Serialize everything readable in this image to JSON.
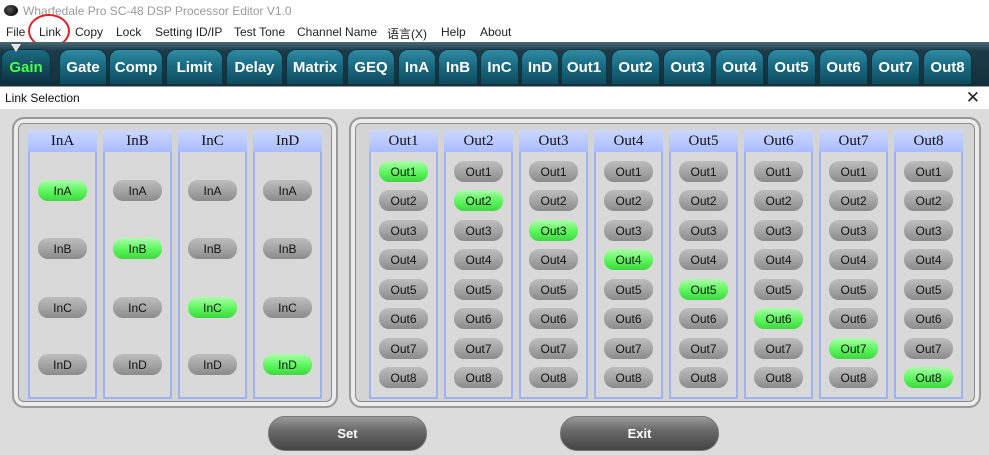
{
  "window": {
    "title": "Wharfedale Pro SC-48 DSP Processor Editor V1.0",
    "icon": "speaker-logo-icon"
  },
  "menu": [
    "File",
    "Link",
    "Copy",
    "Lock",
    "Setting ID/IP",
    "Test Tone",
    "Channel Name",
    "语言(X)",
    "Help",
    "About"
  ],
  "tabs": [
    "Gain",
    "Gate",
    "Comp",
    "Limit",
    "Delay",
    "Matrix",
    "GEQ",
    "InA",
    "InB",
    "InC",
    "InD",
    "Out1",
    "Out2",
    "Out3",
    "Out4",
    "Out5",
    "Out6",
    "Out7",
    "Out8"
  ],
  "active_tab": "Gain",
  "dialog": {
    "title": "Link Selection",
    "close_glyph": "✕",
    "inputs": {
      "columns": [
        "InA",
        "InB",
        "InC",
        "InD"
      ],
      "options": [
        "InA",
        "InB",
        "InC",
        "InD"
      ]
    },
    "outputs": {
      "columns": [
        "Out1",
        "Out2",
        "Out3",
        "Out4",
        "Out5",
        "Out6",
        "Out7",
        "Out8"
      ],
      "options": [
        "Out1",
        "Out2",
        "Out3",
        "Out4",
        "Out5",
        "Out6",
        "Out7",
        "Out8"
      ]
    },
    "set_label": "Set",
    "exit_label": "Exit"
  },
  "colors": {
    "selected": "#5cf55c",
    "unselected": "#a3a3a3",
    "active_tab_text": "#4cff4c",
    "highlight_circle": "#e0202a"
  }
}
